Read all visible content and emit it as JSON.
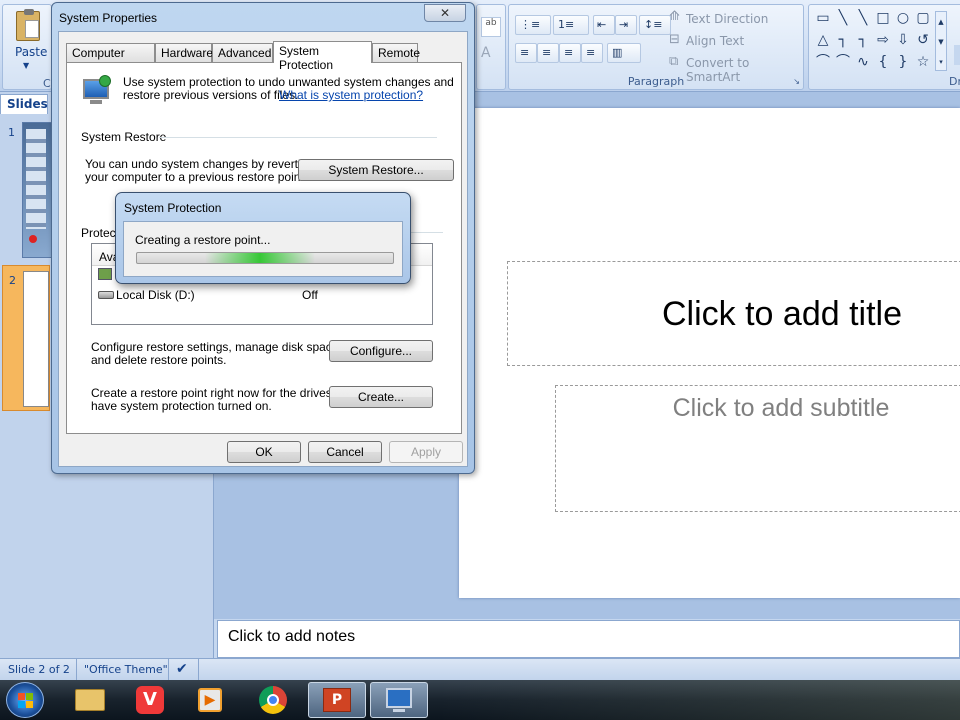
{
  "ribbon": {
    "paste_label": "Paste",
    "paragraph_label": "Paragraph",
    "drawing_label": "Dr",
    "text_direction": "Text Direction",
    "align_text": "Align Text",
    "convert_smartart": "Convert to SmartArt"
  },
  "slides_pane": {
    "tab_label": "Slides",
    "thumbs": [
      {
        "num": "1"
      },
      {
        "num": "2"
      }
    ]
  },
  "slide": {
    "title_placeholder": "Click to add title",
    "subtitle_placeholder": "Click to add subtitle"
  },
  "notes": {
    "placeholder": "Click to add notes"
  },
  "status": {
    "slide": "Slide 2 of 2",
    "theme": "\"Office Theme\""
  },
  "system_properties": {
    "title": "System Properties",
    "close": "✕",
    "tabs": [
      "Computer Name",
      "Hardware",
      "Advanced",
      "System Protection",
      "Remote"
    ],
    "selected_tab": "System Protection",
    "intro_line1": "Use system protection to undo unwanted system changes and",
    "intro_line2": "restore previous versions of files.",
    "intro_link": "What is system protection?",
    "restore_header": "System Restore",
    "restore_text1": "You can undo system changes by reverting",
    "restore_text2": "your computer to a previous restore point.",
    "restore_button": "System Restore...",
    "protection_header": "Protecti",
    "drives_col_header": "Ava",
    "drives": [
      {
        "name": "Local Disk (D:)",
        "protection": "Off"
      }
    ],
    "configure_text1": "Configure restore settings, manage disk space,",
    "configure_text2": "and delete restore points.",
    "configure_button": "Configure...",
    "create_text1": "Create a restore point right now for the drives that",
    "create_text2": "have system protection turned on.",
    "create_button": "Create...",
    "ok": "OK",
    "cancel": "Cancel",
    "apply": "Apply"
  },
  "progress_dialog": {
    "title": "System Protection",
    "message": "Creating a restore point..."
  }
}
